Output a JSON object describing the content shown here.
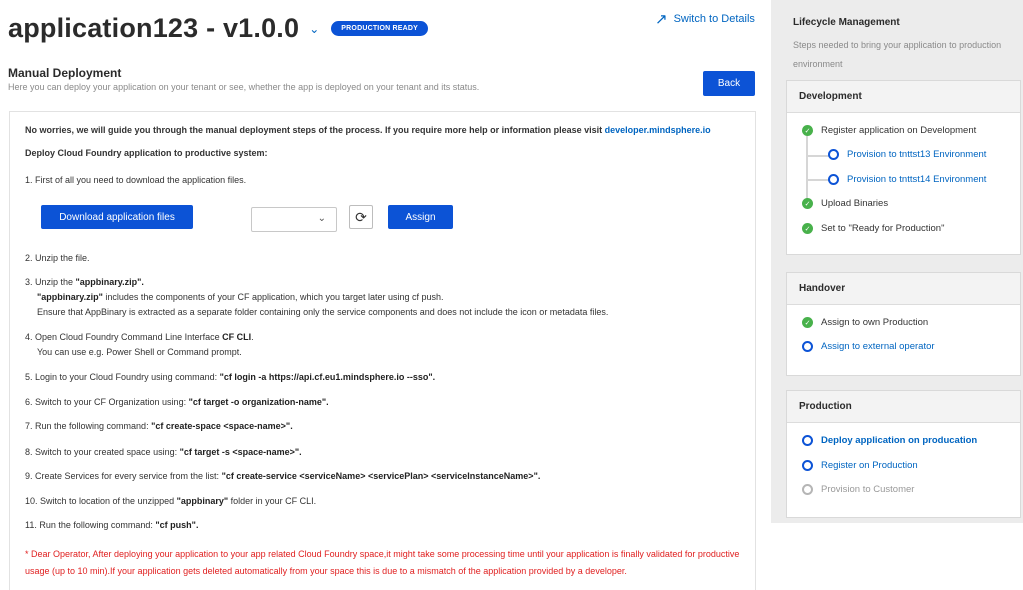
{
  "header": {
    "app_title": "application123 - v1.0.0",
    "badge": "PRODUCTION READY",
    "switch_link": "Switch to Details"
  },
  "section": {
    "title": "Manual Deployment",
    "subtitle": "Here you can deploy your application on your tenant or see, whether the app is deployed on your tenant and its status.",
    "back_label": "Back"
  },
  "main": {
    "intro_text": "No worries, we will guide you through the manual deployment steps of the process. If you require more help or information please visit",
    "intro_link": "developer.mindsphere.io",
    "deploy_heading": "Deploy Cloud Foundry application to productive system:",
    "steps": {
      "s1": "1. First of all you need to download the application files.",
      "s2": "2. Unzip the file.",
      "s3a": "3. Unzip the ",
      "s3a_b": "\"appbinary.zip\".",
      "s3b_b": "\"appbinary.zip\"",
      "s3b": " includes the components of your CF application, which you target later using cf push.",
      "s3c": "Ensure that AppBinary is extracted as a separate folder containing only the service components and does not include the icon or metadata files.",
      "s4a": "4. Open Cloud Foundry Command Line Interface ",
      "s4a_b": "CF CLI",
      "s4a_end": ".",
      "s4b": "You can use e.g. Power Shell or Command prompt.",
      "s5": "5. Login to your Cloud Foundry using command: ",
      "s5_b": "\"cf login -a https://api.cf.eu1.mindsphere.io --sso\".",
      "s6": "6. Switch to your CF Organization using: ",
      "s6_b": "\"cf target -o organization-name\".",
      "s7": "7. Run the following command: ",
      "s7_b": "\"cf create-space <space-name>\".",
      "s8": "8. Switch to your created space using: ",
      "s8_b": "\"cf target -s <space-name>\".",
      "s9": "9. Create Services for every service from the list: ",
      "s9_b": "\"cf create-service <serviceName> <servicePlan> <serviceInstanceName>\".",
      "s10": "10. Switch to location of the unzipped ",
      "s10_b": "\"appbinary\"",
      "s10_end": " folder in your CF CLI.",
      "s11": "11. Run the following command: ",
      "s11_b": "\"cf push\"."
    },
    "download_label": "Download application files",
    "select_value": "",
    "assign_label": "Assign",
    "note": "* Dear Operator, After deploying your application to your app related Cloud Foundry space,it might take some processing time until your application is finally validated for productive usage (up to 10 min).If your application gets deleted automatically from your space this is due to a mismatch of the application provided by a developer."
  },
  "sidebar": {
    "title": "Lifecycle Management",
    "subtitle": "Steps needed to bring your application to production environment",
    "development": {
      "title": "Development",
      "items": [
        {
          "label": "Register application on Development",
          "state": "done"
        },
        {
          "label": "Provision to tnttst13 Environment",
          "state": "open"
        },
        {
          "label": "Provision to tnttst14 Environment",
          "state": "open"
        },
        {
          "label": "Upload Binaries",
          "state": "done"
        },
        {
          "label": "Set to \"Ready for Production\"",
          "state": "done"
        }
      ]
    },
    "handover": {
      "title": "Handover",
      "items": [
        {
          "label": "Assign to own Production",
          "state": "done"
        },
        {
          "label": "Assign to external operator",
          "state": "open"
        }
      ]
    },
    "production": {
      "title": "Production",
      "items": [
        {
          "label": "Deploy application on producation",
          "state": "active"
        },
        {
          "label": "Register on Production",
          "state": "open"
        },
        {
          "label": "Provision to Customer",
          "state": "disabled"
        }
      ]
    }
  },
  "colors": {
    "primary": "#0c53d6",
    "link": "#0065c1",
    "success": "#48b14b",
    "warning_text": "#e02020"
  }
}
